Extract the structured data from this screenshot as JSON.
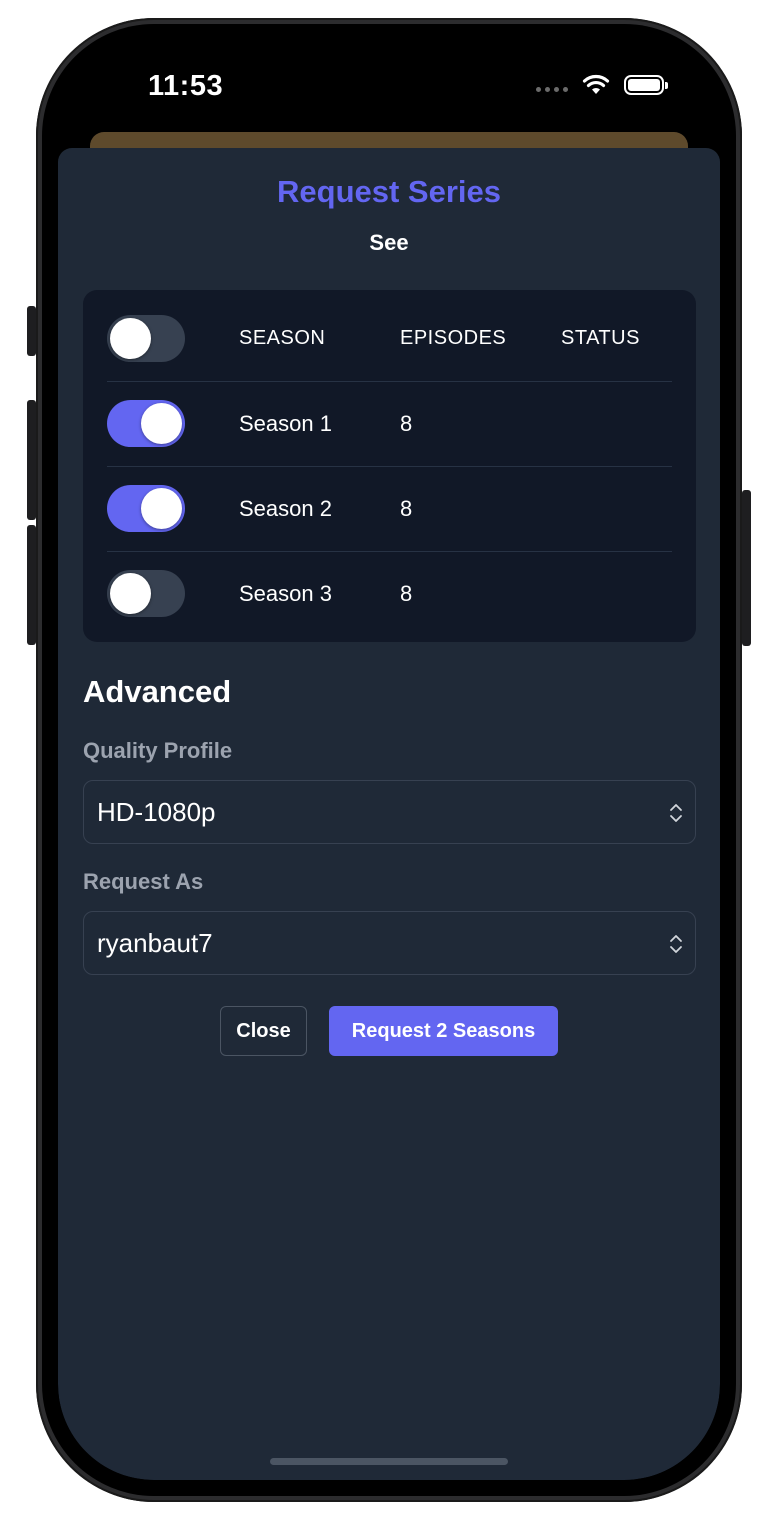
{
  "status_bar": {
    "time": "11:53",
    "icons": [
      "signal-dots-icon",
      "wifi-icon",
      "battery-icon"
    ]
  },
  "modal": {
    "title": "Request Series",
    "subtitle": "See",
    "season_table": {
      "headers": {
        "season": "SEASON",
        "episodes": "EPISODES",
        "status": "STATUS"
      },
      "select_all_toggle": false,
      "rows": [
        {
          "season": "Season 1",
          "episodes": "8",
          "status": "",
          "selected": true
        },
        {
          "season": "Season 2",
          "episodes": "8",
          "status": "",
          "selected": true
        },
        {
          "season": "Season 3",
          "episodes": "8",
          "status": "",
          "selected": false
        }
      ]
    },
    "advanced": {
      "title": "Advanced",
      "quality_profile": {
        "label": "Quality Profile",
        "value": "HD-1080p"
      },
      "request_as": {
        "label": "Request As",
        "value": "ryanbaut7"
      }
    },
    "buttons": {
      "close_label": "Close",
      "request_label": "Request 2 Seasons"
    }
  },
  "colors": {
    "accent": "#6366f1",
    "modal_bg": "#1f2937",
    "table_bg": "#111827",
    "muted_text": "#9ca3af",
    "toggle_off": "#374151"
  }
}
